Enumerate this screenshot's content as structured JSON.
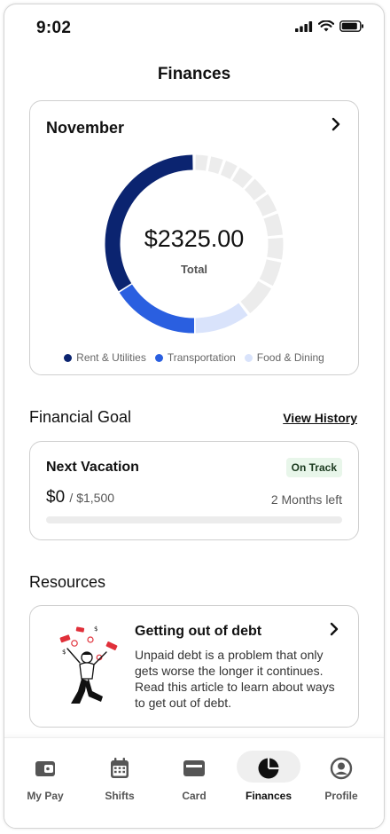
{
  "status": {
    "time": "9:02"
  },
  "header": {
    "title": "Finances"
  },
  "month_card": {
    "month": "November",
    "total_amount": "$2325.00",
    "total_label": "Total",
    "legend": [
      {
        "label": "Rent & Utilities",
        "color": "#0b2470"
      },
      {
        "label": "Transportation",
        "color": "#2a5fe0"
      },
      {
        "label": "Food & Dining",
        "color": "#d9e3fb"
      }
    ]
  },
  "goal_section": {
    "title": "Financial Goal",
    "view_history": "View History",
    "goal": {
      "name": "Next Vacation",
      "status": "On Track",
      "saved": "$0",
      "target": "/ $1,500",
      "time_left": "2 Months left",
      "progress": 0
    }
  },
  "resources": {
    "title": "Resources",
    "article": {
      "title": "Getting out of debt",
      "description": "Unpaid debt is a problem that only gets worse the longer it continues. Read this article to learn about ways to get out of debt."
    }
  },
  "tabs": [
    {
      "label": "My Pay",
      "icon": "wallet-icon"
    },
    {
      "label": "Shifts",
      "icon": "calendar-icon"
    },
    {
      "label": "Card",
      "icon": "card-icon"
    },
    {
      "label": "Finances",
      "icon": "pie-chart-icon",
      "active": true
    },
    {
      "label": "Profile",
      "icon": "user-icon"
    }
  ]
}
